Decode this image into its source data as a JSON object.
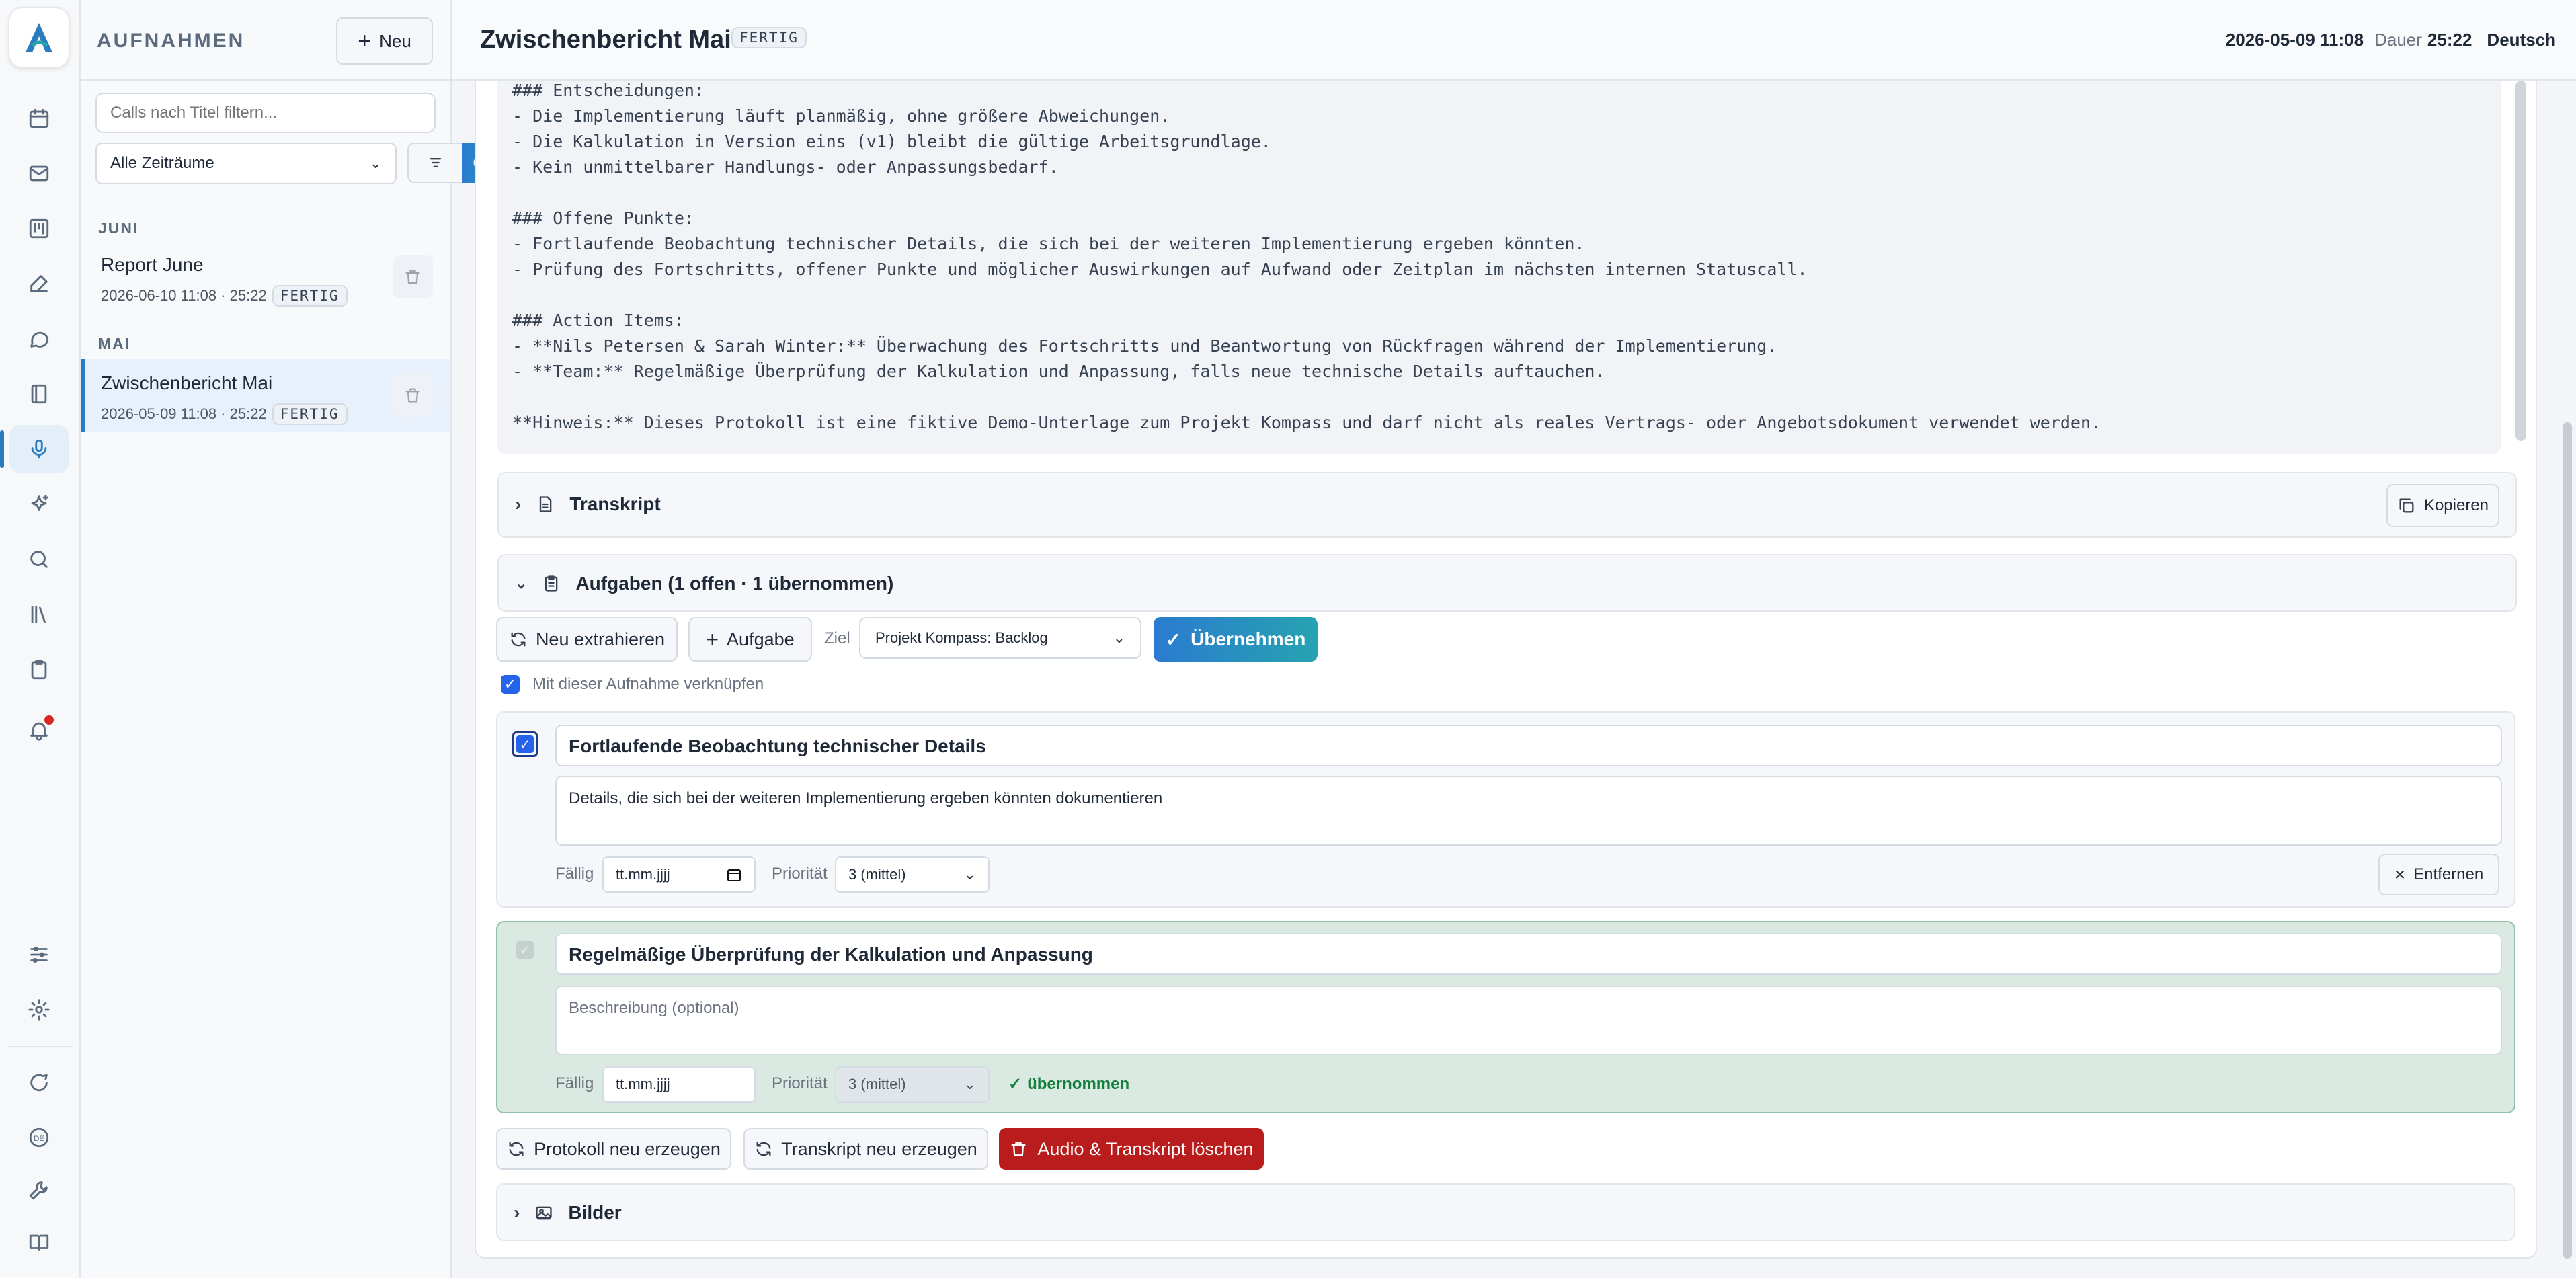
{
  "sidebar": {
    "title": "AUFNAHMEN",
    "new_label": "Neu",
    "filter_placeholder": "Calls nach Titel filtern...",
    "period_select": "Alle Zeiträume",
    "groups": [
      {
        "label": "JUNI",
        "items": [
          {
            "title": "Report June",
            "meta": "2026-06-10 11:08 · 25:22",
            "badge": "FERTIG"
          }
        ]
      },
      {
        "label": "MAI",
        "items": [
          {
            "title": "Zwischenbericht Mai",
            "meta": "2026-05-09 11:08 · 25:22",
            "badge": "FERTIG"
          }
        ]
      }
    ]
  },
  "header": {
    "title": "Zwischenbericht Mai",
    "status": "FERTIG",
    "datetime": "2026-05-09 11:08",
    "duration_label": "Dauer",
    "duration": "25:22",
    "language": "Deutsch"
  },
  "protocol": {
    "text": "### Entscheidungen:\n- Die Implementierung läuft planmäßig, ohne größere Abweichungen.\n- Die Kalkulation in Version eins (v1) bleibt die gültige Arbeitsgrundlage.\n- Kein unmittelbarer Handlungs- oder Anpassungsbedarf.\n\n### Offene Punkte:\n- Fortlaufende Beobachtung technischer Details, die sich bei der weiteren Implementierung ergeben könnten.\n- Prüfung des Fortschritts, offener Punkte und möglicher Auswirkungen auf Aufwand oder Zeitplan im nächsten internen Statuscall.\n\n### Action Items:\n- **Nils Petersen & Sarah Winter:** Überwachung des Fortschritts und Beantwortung von Rückfragen während der Implementierung.\n- **Team:** Regelmäßige Überprüfung der Kalkulation und Anpassung, falls neue technische Details auftauchen.\n\n**Hinweis:** Dieses Protokoll ist eine fiktive Demo-Unterlage zum Projekt Kompass und darf nicht als reales Vertrags- oder Angebotsdokument verwendet werden."
  },
  "transcript": {
    "title": "Transkript",
    "copy_label": "Kopieren"
  },
  "tasks": {
    "title": "Aufgaben (1 offen · 1 übernommen)",
    "reextract_label": "Neu extrahieren",
    "add_label": "Aufgabe",
    "target_label": "Ziel",
    "target_value": "Projekt Kompass: Backlog",
    "accept_label": "Übernehmen",
    "link_label": "Mit dieser Aufnahme verknüpfen",
    "due_label": "Fällig",
    "priority_label": "Priorität",
    "items": [
      {
        "title": "Fortlaufende Beobachtung technischer Details",
        "description": "Details, die sich bei der weiteren Implementierung ergeben könnten dokumentieren",
        "due": "tt.mm.jjjj",
        "priority": "3 (mittel)",
        "remove_label": "Entfernen"
      },
      {
        "title": "Regelmäßige Überprüfung der Kalkulation und Anpassung",
        "description_placeholder": "Beschreibung (optional)",
        "due": "tt.mm.jjjj",
        "priority": "3 (mittel)",
        "status": "übernommen"
      }
    ]
  },
  "actions": {
    "regen_protocol": "Protokoll neu erzeugen",
    "regen_transcript": "Transkript neu erzeugen",
    "delete": "Audio & Transkript löschen"
  },
  "images": {
    "title": "Bilder"
  },
  "colors": {
    "accent": "#2b7bbf",
    "danger": "#b91c1c",
    "success": "#15803d"
  }
}
